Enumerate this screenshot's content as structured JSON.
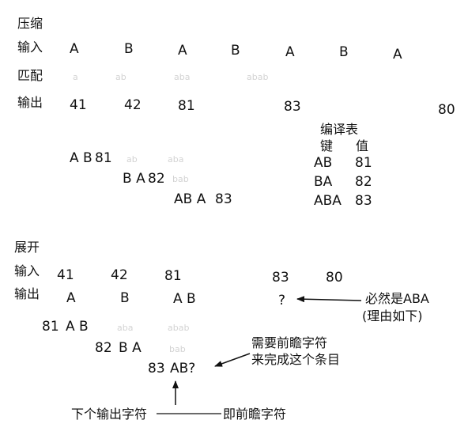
{
  "compression": {
    "title": "压缩",
    "input_label": "输入",
    "input_values": [
      "A",
      "B",
      "A",
      "B",
      "A",
      "B",
      "A"
    ],
    "match_label": "匹配",
    "match_faint": [
      "a",
      "ab",
      "aba",
      "abab"
    ],
    "output_label": "输出",
    "output_values": [
      "41",
      "42",
      "81",
      "83",
      "80"
    ],
    "steps": [
      {
        "seq": "A B",
        "code": "81",
        "faint": [
          "ab",
          "aba"
        ]
      },
      {
        "seq": "B A",
        "code": "82",
        "faint": [
          "bab"
        ]
      },
      {
        "seq": "AB A",
        "code": "83"
      }
    ],
    "table": {
      "title": "编译表",
      "col_key": "键",
      "col_value": "值",
      "rows": [
        {
          "key": "AB",
          "value": "81"
        },
        {
          "key": "BA",
          "value": "82"
        },
        {
          "key": "ABA",
          "value": "83"
        }
      ]
    }
  },
  "expansion": {
    "title": "展开",
    "input_label": "输入",
    "input_values": [
      "41",
      "42",
      "81",
      "83",
      "80"
    ],
    "output_label": "输出",
    "output_values": [
      "A",
      "B",
      "A B",
      "?"
    ],
    "steps": [
      {
        "code": "81",
        "seq": "A B",
        "faint": [
          "aba",
          "abab"
        ]
      },
      {
        "code": "82",
        "seq": "B A",
        "faint": [
          "bab"
        ]
      },
      {
        "code": "83",
        "seq": "AB?"
      }
    ],
    "annotations": {
      "must_be_line1": "必然是ABA",
      "must_be_line2": "(理由如下)",
      "lookahead_line1": "需要前瞻字符",
      "lookahead_line2": "来完成这个条目",
      "next_char": "下个输出字符",
      "lookahead_char": "即前瞻字符"
    }
  },
  "colors": {
    "text": "#111111",
    "faint": "#d3d3d3",
    "arrow": "#111111"
  }
}
